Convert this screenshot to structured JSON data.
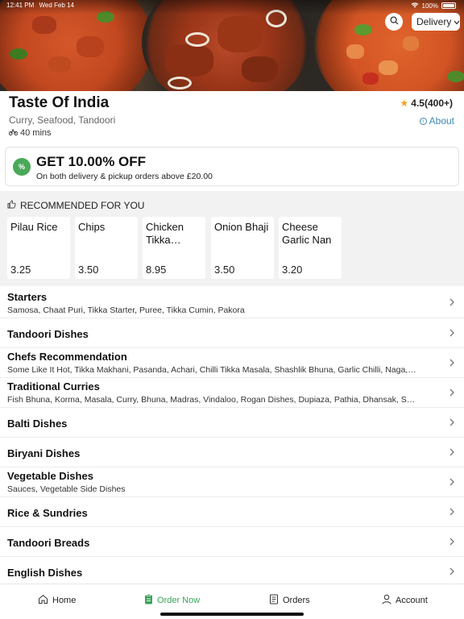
{
  "status_bar": {
    "time": "12:41 PM",
    "date": "Wed Feb 14",
    "battery": "100%"
  },
  "header": {
    "delivery_label": "Delivery"
  },
  "restaurant": {
    "name": "Taste Of India",
    "cuisines": "Curry, Seafood, Tandoori",
    "delivery_time": "40 mins",
    "rating": "4.5(400+)",
    "about_label": "About"
  },
  "offer": {
    "badge": "%",
    "title": "GET 10.00% OFF",
    "subtitle": "On both delivery & pickup orders above £20.00"
  },
  "recommended": {
    "title": "RECOMMENDED FOR YOU",
    "items": [
      {
        "name": "Pilau Rice",
        "price": "3.25"
      },
      {
        "name": "Chips",
        "price": "3.50"
      },
      {
        "name": "Chicken Tikka Masala",
        "price": "8.95"
      },
      {
        "name": "Onion Bhaji",
        "price": "3.50"
      },
      {
        "name": "Cheese Garlic Nan",
        "price": "3.20"
      }
    ]
  },
  "categories": [
    {
      "name": "Starters",
      "subtitle": "Samosa, Chaat Puri, Tikka Starter, Puree, Tikka Cumin, Pakora"
    },
    {
      "name": "Tandoori Dishes",
      "subtitle": ""
    },
    {
      "name": "Chefs Recommendation",
      "subtitle": "Some Like It Hot, Tikka Makhani, Pasanda, Achari, Chilli Tikka Masala, Shashlik Bhuna, Garlic Chilli, Naga, R..."
    },
    {
      "name": "Traditional Curries",
      "subtitle": "Fish Bhuna, Korma, Masala, Curry, Bhuna, Madras, Vindaloo, Rogan Dishes, Dupiaza, Pathia, Dhansak, Sagw..."
    },
    {
      "name": "Balti Dishes",
      "subtitle": ""
    },
    {
      "name": "Biryani Dishes",
      "subtitle": ""
    },
    {
      "name": "Vegetable Dishes",
      "subtitle": "Sauces, Vegetable Side Dishes"
    },
    {
      "name": "Rice & Sundries",
      "subtitle": ""
    },
    {
      "name": "Tandoori Breads",
      "subtitle": ""
    },
    {
      "name": "English Dishes",
      "subtitle": ""
    }
  ],
  "bottom_nav": {
    "home": "Home",
    "order_now": "Order Now",
    "orders": "Orders",
    "account": "Account"
  },
  "colors": {
    "accent_green": "#3aa35a",
    "link_blue": "#3a88b8",
    "star": "#f0a020"
  }
}
